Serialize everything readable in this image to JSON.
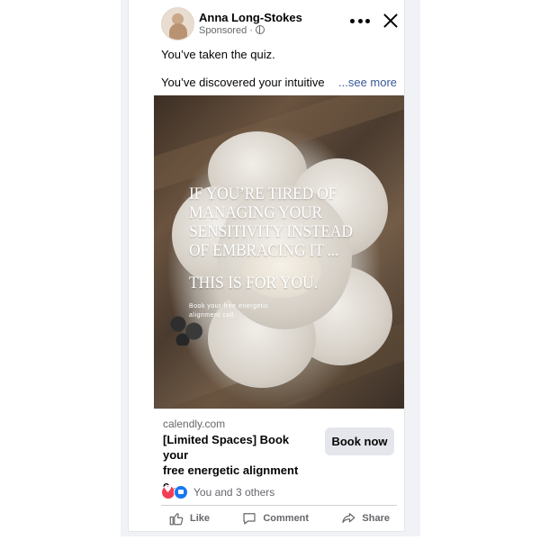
{
  "post": {
    "author": "Anna Long-Stokes",
    "sponsored_label": "Sponsored ·",
    "text_line_1": "You’ve taken the quiz.",
    "text_line_2": "You’ve discovered your intuitive",
    "see_more": "...see more"
  },
  "ad_image": {
    "headline_lines": [
      "IF YOU’RE TIRED OF",
      "MANAGING YOUR",
      "SENSITIVITY INSTEAD",
      "OF EMBRACING IT ..."
    ],
    "subheadline": "THIS IS FOR YOU.",
    "tagline_lines": [
      "Book your free energetic",
      "alignment call."
    ]
  },
  "link_preview": {
    "domain": "calendly.com",
    "title_lines": [
      "[Limited Spaces] Book your",
      "free energetic alignment c..."
    ],
    "cta": "Book now"
  },
  "engagement": {
    "reactions_text": "You and 3 others",
    "actions": [
      "Like",
      "Comment",
      "Share"
    ]
  },
  "icons": [
    "avatar",
    "globe-icon",
    "more-icon",
    "close-icon",
    "love-reaction-icon",
    "like-reaction-icon",
    "like-icon",
    "comment-icon",
    "share-icon"
  ],
  "colors": {
    "link": "#385898",
    "secondary_text": "#65676b",
    "like_blue": "#1877f2",
    "love_red": "#f33e58",
    "button_bg": "#e4e6eb"
  }
}
